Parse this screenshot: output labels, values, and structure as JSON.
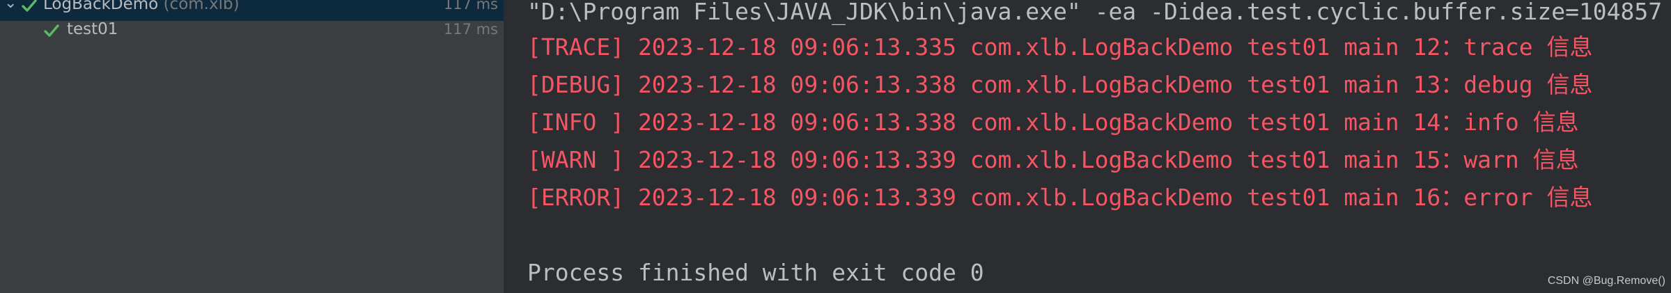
{
  "test_tree": {
    "rows": [
      {
        "name": "LogBackDemo",
        "package": "(com.xlb)",
        "time": "117 ms",
        "status_icon": "check-icon",
        "expand_icon": "chevron-down-icon"
      },
      {
        "name": "test01",
        "time": "117 ms",
        "status_icon": "check-icon"
      }
    ]
  },
  "console": {
    "command": "\"D:\\Program Files\\JAVA_JDK\\bin\\java.exe\" -ea -Didea.test.cyclic.buffer.size=104857",
    "log_lines": [
      "[TRACE] 2023-12-18 09:06:13.335 com.xlb.LogBackDemo test01 main 12：trace 信息",
      "[DEBUG] 2023-12-18 09:06:13.338 com.xlb.LogBackDemo test01 main 13：debug 信息",
      "[INFO ] 2023-12-18 09:06:13.338 com.xlb.LogBackDemo test01 main 14：info 信息",
      "[WARN ] 2023-12-18 09:06:13.339 com.xlb.LogBackDemo test01 main 15：warn 信息",
      "[ERROR] 2023-12-18 09:06:13.339 com.xlb.LogBackDemo test01 main 16：error 信息"
    ],
    "finish_text": "Process finished with exit code 0"
  },
  "watermark": "CSDN @Bug.Remove()",
  "colors": {
    "tree_bg": "#3c3f41",
    "selected_row": "#0d293e",
    "console_bg": "#2b2d30",
    "log_red": "#f75464",
    "check_green": "#5fb865",
    "text_default": "#bcbec4"
  }
}
